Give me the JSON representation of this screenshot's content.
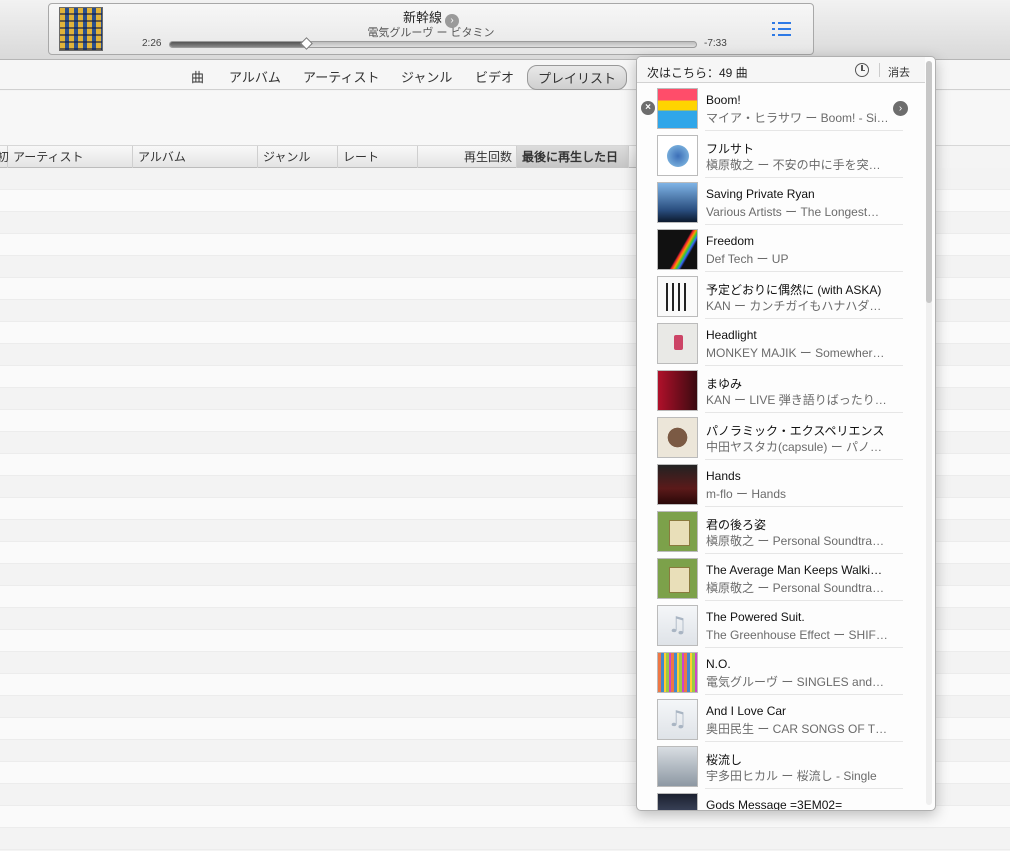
{
  "player": {
    "title": "新幹線",
    "subtitle": "電気グルーヴ ー ビタミン",
    "elapsed": "2:26",
    "remaining": "-7:33",
    "progress": 0.26
  },
  "nav": {
    "tabs": [
      "曲",
      "アルバム",
      "アーティスト",
      "ジャンル",
      "ビデオ",
      "プレイリスト"
    ],
    "active": "プレイリスト"
  },
  "columns": {
    "partial": "初",
    "artist": "アーティスト",
    "album": "アルバム",
    "genre": "ジャンル",
    "rating": "レート",
    "plays": "再生回数",
    "last_played": "最後に再生した日 ▲"
  },
  "queue": {
    "header": "次はこちら：49 曲",
    "clear_label": "消去",
    "items": [
      {
        "title": "Boom!",
        "sub": "マイア・ヒラサワ ー Boom! - Si…",
        "art": "boom"
      },
      {
        "title": "フルサト",
        "sub": "槇原敬之 ー 不安の中に手を突…",
        "art": "furu"
      },
      {
        "title": "Saving Private Ryan",
        "sub": "Various Artists ー The Longest…",
        "art": "ryan"
      },
      {
        "title": "Freedom",
        "sub": "Def Tech ー UP",
        "art": "def"
      },
      {
        "title": "予定どおりに偶然に (with ASKA)",
        "sub": "KAN ー カンチガイもハナハダ…",
        "art": "kan1"
      },
      {
        "title": "Headlight",
        "sub": "MONKEY MAJIK ー Somewher…",
        "art": "head"
      },
      {
        "title": "まゆみ",
        "sub": "KAN ー LIVE 弾き語りばったり…",
        "art": "mayu"
      },
      {
        "title": "パノラミック・エクスペリエンス",
        "sub": "中田ヤスタカ(capsule) ー パノ…",
        "art": "pano"
      },
      {
        "title": "Hands",
        "sub": "m-flo ー Hands",
        "art": "hands"
      },
      {
        "title": "君の後ろ姿",
        "sub": "槇原敬之 ー Personal Soundtra…",
        "art": "kimi"
      },
      {
        "title": "The Average Man Keeps Walki…",
        "sub": "槇原敬之 ー Personal Soundtra…",
        "art": "kimi"
      },
      {
        "title": "The Powered Suit.",
        "sub": "The Greenhouse Effect ー SHIF…",
        "art": "note"
      },
      {
        "title": "N.O.",
        "sub": "電気グルーヴ ー SINGLES and…",
        "art": "no"
      },
      {
        "title": "And I Love Car",
        "sub": "奥田民生 ー CAR SONGS OF T…",
        "art": "note"
      },
      {
        "title": "桜流し",
        "sub": "宇多田ヒカル ー 桜流し - Single",
        "art": "saku"
      },
      {
        "title": "Gods Message =3EM02=",
        "sub": "",
        "art": "gods"
      }
    ]
  }
}
